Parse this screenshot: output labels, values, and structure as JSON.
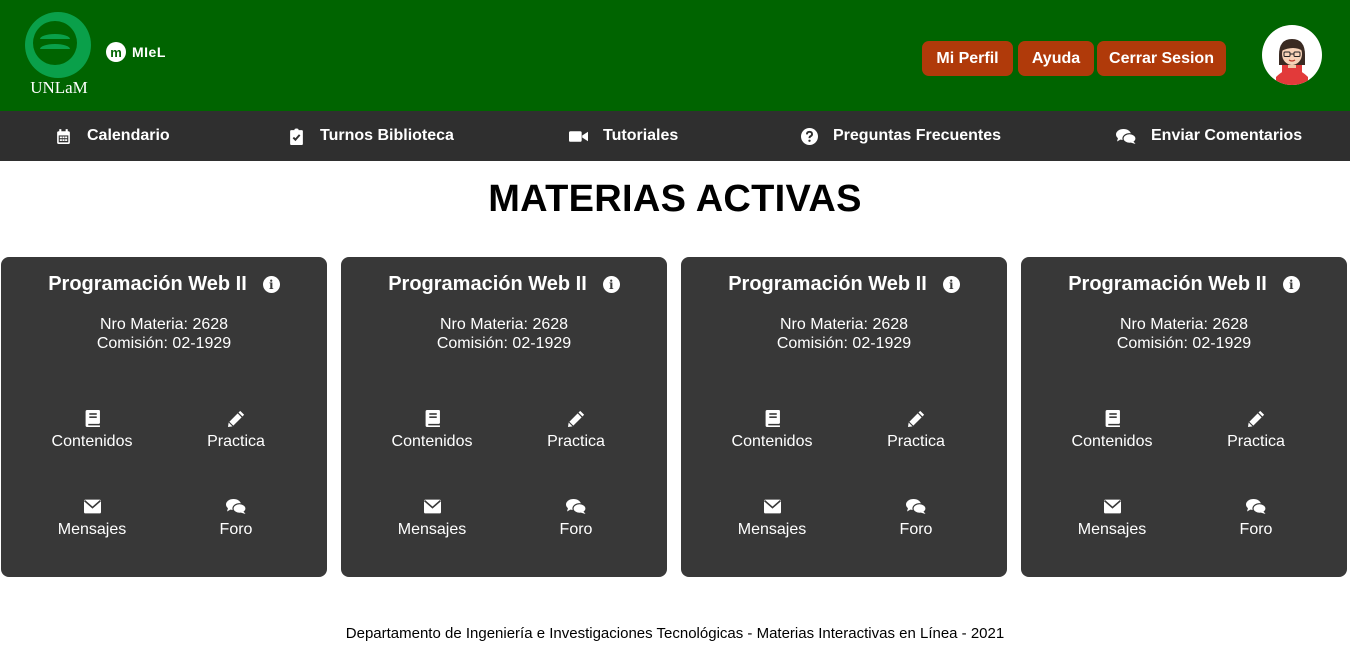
{
  "header": {
    "logo_text": "UNLaM",
    "miel_badge": "m",
    "miel_text": "MIeL",
    "buttons": {
      "perfil": "Mi Perfil",
      "ayuda": "Ayuda",
      "cerrar": "Cerrar Sesion"
    },
    "colors": {
      "header_bg": "#006400",
      "button_bg": "#b03a0a"
    }
  },
  "nav": {
    "items": [
      {
        "label": "Calendario",
        "icon": "calendar-icon"
      },
      {
        "label": "Turnos Biblioteca",
        "icon": "clipboard-check-icon"
      },
      {
        "label": "Tutoriales",
        "icon": "video-icon"
      },
      {
        "label": "Preguntas Frecuentes",
        "icon": "question-circle-icon"
      },
      {
        "label": "Enviar Comentarios",
        "icon": "comments-icon"
      }
    ]
  },
  "page": {
    "title": "MATERIAS ACTIVAS"
  },
  "cards": [
    {
      "title": "Programación Web II",
      "nro": "Nro Materia: 2628",
      "comision": "Comisión: 02-1929",
      "actions": {
        "contenidos": "Contenidos",
        "practica": "Practica",
        "mensajes": "Mensajes",
        "foro": "Foro"
      }
    },
    {
      "title": "Programación Web II",
      "nro": "Nro Materia: 2628",
      "comision": "Comisión: 02-1929",
      "actions": {
        "contenidos": "Contenidos",
        "practica": "Practica",
        "mensajes": "Mensajes",
        "foro": "Foro"
      }
    },
    {
      "title": "Programación Web II",
      "nro": "Nro Materia: 2628",
      "comision": "Comisión: 02-1929",
      "actions": {
        "contenidos": "Contenidos",
        "practica": "Practica",
        "mensajes": "Mensajes",
        "foro": "Foro"
      }
    },
    {
      "title": "Programación Web II",
      "nro": "Nro Materia: 2628",
      "comision": "Comisión: 02-1929",
      "actions": {
        "contenidos": "Contenidos",
        "practica": "Practica",
        "mensajes": "Mensajes",
        "foro": "Foro"
      }
    }
  ],
  "footer": {
    "text": "Departamento de Ingeniería e Investigaciones Tecnológicas - Materias Interactivas en Línea - 2021"
  }
}
